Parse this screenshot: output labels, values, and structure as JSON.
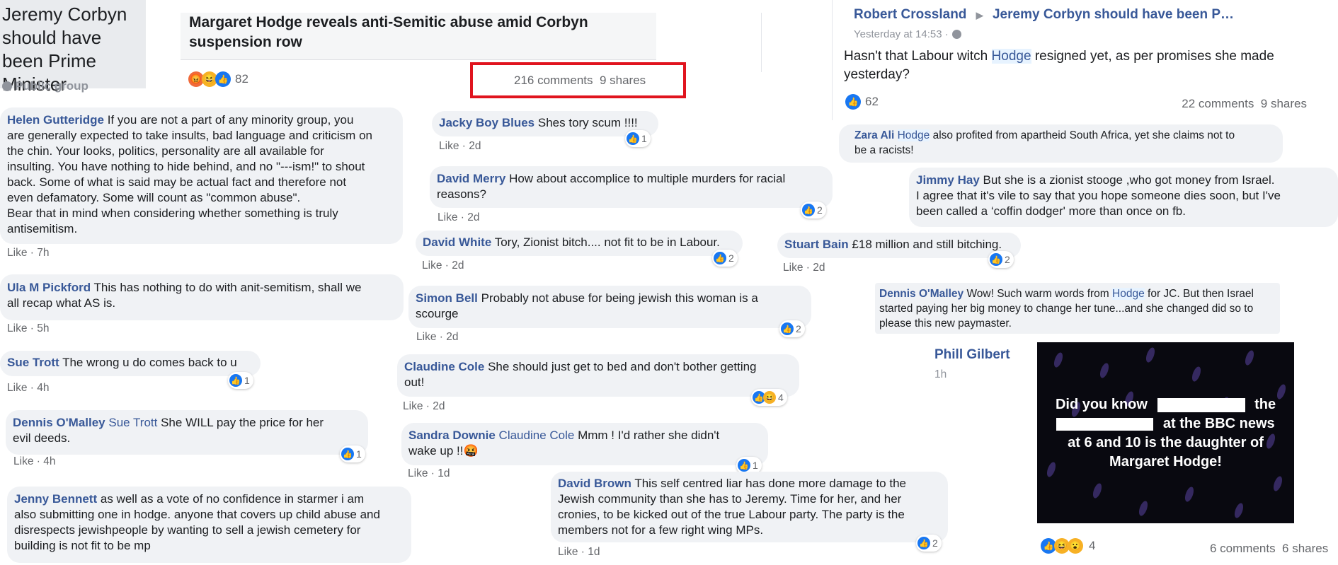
{
  "group": {
    "name": "Jeremy Corbyn should have been Prime Minister",
    "privacy": "Public group",
    "privacy_icon": "globe-icon"
  },
  "post": {
    "title": "Margaret Hodge reveals anti-Semitic abuse amid Corbyn suspension row",
    "reaction_count": "82",
    "reaction_icons": [
      "angry",
      "haha",
      "like"
    ],
    "comments": "216 comments",
    "shares": "9 shares",
    "highlight_color": "#e0141e"
  },
  "comments_left": [
    {
      "name": "Helen Gutteridge",
      "lines": [
        "If you are not a part of any minority group, you",
        "are generally expected to take insults, bad language and criticism on",
        "the chin. Your looks, politics, personality are all available for",
        "insulting. You have nothing to hide behind, and no \"---ism!\" to shout",
        "back. Some of what is said may be actual fact and therefore not",
        "even defamatory. Some will count as \"common abuse\".",
        "Bear that in mind when considering whether something is truly",
        "antisemitism."
      ],
      "like": "Like",
      "time": "7h"
    },
    {
      "name": "Ula M Pickford",
      "lines": [
        "This has nothing to do with anit-semitism, shall we",
        "all recap what AS is."
      ],
      "like": "Like",
      "time": "5h"
    },
    {
      "name": "Sue Trott",
      "lines": [
        "The wrong u do comes back to u"
      ],
      "like": "Like",
      "time": "4h",
      "reactions": "1"
    },
    {
      "name": "Dennis O'Malley",
      "mention": "Sue Trott",
      "lines": [
        "She WILL pay the price for her",
        "evil deeds."
      ],
      "like": "Like",
      "time": "4h",
      "reactions": "1"
    },
    {
      "name": "Jenny Bennett",
      "lines": [
        "as well as a vote of no confidence in starmer i am",
        "also submitting one in hodge. anyone that covers up child abuse and",
        "disrespects jewishpeople by wanting to sell a jewish cemetery for",
        "building is not fit to be mp"
      ]
    }
  ],
  "comments_middle": [
    {
      "name": "Jacky Boy Blues",
      "lines": [
        "Shes tory scum !!!!"
      ],
      "like": "Like",
      "time": "2d",
      "reactions": "1"
    },
    {
      "name": "David Merry",
      "lines": [
        "How about accomplice to multiple murders for racial",
        "reasons?"
      ],
      "like": "Like",
      "time": "2d",
      "reactions": "2"
    },
    {
      "name": "David White",
      "lines": [
        "Tory, Zionist bitch.... not fit to be in Labour."
      ],
      "like": "Like",
      "time": "2d",
      "reactions": "2"
    },
    {
      "name": "Simon Bell",
      "lines": [
        "Probably not abuse for being jewish this woman is a",
        "scourge"
      ],
      "like": "Like",
      "time": "2d",
      "reactions": "2"
    },
    {
      "name": "Claudine Cole",
      "lines": [
        "She should just get to bed and don't bother getting",
        "out!"
      ],
      "like": "Like",
      "time": "2d",
      "reactions": "4"
    },
    {
      "name": "Sandra Downie",
      "mention": "Claudine Cole",
      "lines": [
        "Mmm ! I'd rather she didn't",
        "wake up !!🤬"
      ],
      "like": "Like",
      "time": "1d",
      "reactions": "1"
    },
    {
      "name": "David Brown",
      "lines": [
        "This self centred liar has done more damage to the",
        "Jewish community than she has to Jeremy. Time for her, and her",
        "cronies, to be kicked out of the true Labour party. The party is the",
        "members not for a few right wing MPs."
      ],
      "like": "Like",
      "time": "1d",
      "reactions": "2"
    }
  ],
  "right_post": {
    "author": "Robert Crossland",
    "group": "Jeremy Corbyn should have been P…",
    "time": "Yesterday at 14:53 ·",
    "text_lines": [
      "Hasn't that Labour witch",
      "Hodge",
      "resigned yet, as per promises she made",
      "yesterday?"
    ],
    "reaction_count": "62",
    "comments": "22 comments",
    "shares": "9 shares"
  },
  "comments_right": [
    {
      "name": "Zara Ali",
      "highlight": "Hodge",
      "lines": [
        "also profited from apartheid South Africa, yet she claims not to",
        "be a racists!"
      ]
    },
    {
      "name": "Jimmy Hay",
      "lines": [
        "But she is a zionist stooge ,who got money from Israel.",
        "I agree that it's vile to say that you hope someone dies soon, but I've",
        "been called a ‘coffin dodger' more than once on fb."
      ]
    },
    {
      "name": "Stuart Bain",
      "lines": [
        "£18 million and still bitching."
      ],
      "reactions": "2",
      "like": "Like",
      "time": "2d"
    },
    {
      "name": "Dennis O'Malley",
      "lines": [
        "Wow! Such warm words from",
        "Hodge",
        "for JC. But then Israel",
        "started paying her big money to change her tune...and she changed did so to",
        "please this new paymaster."
      ]
    }
  ],
  "phill": {
    "name": "Phill Gilbert",
    "time": "1h",
    "image_lines": [
      "Did you know",
      "the",
      "at the BBC news",
      "at 6 and 10 is the daughter of",
      "Margaret Hodge!"
    ],
    "reaction_count": "4",
    "comments": "6 comments",
    "shares": "6 shares"
  },
  "colors": {
    "link": "#385898",
    "bubble": "#f0f2f5",
    "like_blue": "#1877f2",
    "highlight_box": "#e0141e"
  }
}
